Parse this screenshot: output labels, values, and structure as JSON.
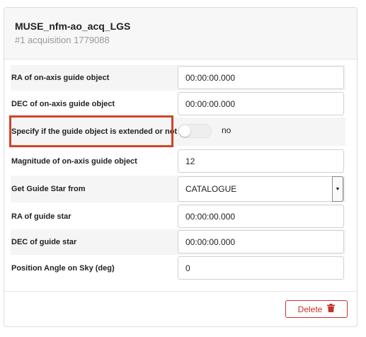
{
  "header": {
    "title": "MUSE_nfm-ao_acq_LGS",
    "subtitle": "#1 acquisition 1779088"
  },
  "params": [
    {
      "label": "RA of on-axis guide object",
      "value": "00:00:00.000"
    },
    {
      "label": "DEC of on-axis guide object",
      "value": "00:00:00.000"
    },
    {
      "label": "Specify if the guide object is extended or not",
      "toggle_state": "no"
    },
    {
      "label": "Magnitude of on-axis guide object",
      "value": "12"
    },
    {
      "label": "Get Guide Star from",
      "value": "CATALOGUE"
    },
    {
      "label": "RA of guide star",
      "value": "00:00:00.000"
    },
    {
      "label": "DEC of guide star",
      "value": "00:00:00.000"
    },
    {
      "label": "Position Angle on Sky (deg)",
      "value": "0"
    }
  ],
  "footer": {
    "delete_label": "Delete",
    "delete_icon": "trash-icon",
    "accent_color": "#c9302c"
  },
  "highlight_color": "#d0442a"
}
